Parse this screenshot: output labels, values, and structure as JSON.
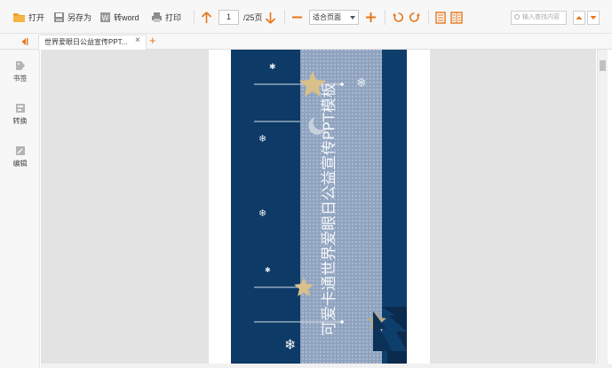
{
  "toolbar": {
    "open_label": "打开",
    "saveas_label": "另存为",
    "toword_label": "转word",
    "print_label": "打印",
    "page_current": "1",
    "page_total": "/25页",
    "zoom_value": "适合页面",
    "search_placeholder": "输入查找内容"
  },
  "tab": {
    "title": "世界爱眼日公益宣传PPT...",
    "close_glyph": "×",
    "add_glyph": "+"
  },
  "sidebar": {
    "items": [
      {
        "label": "书签",
        "icon": "bookmark-icon"
      },
      {
        "label": "转换",
        "icon": "convert-icon"
      },
      {
        "label": "编辑",
        "icon": "edit-icon"
      }
    ]
  },
  "slide": {
    "title": "可爱卡通世界爱眼日公益宣传PPT模板"
  },
  "colors": {
    "accent": "#e8761a",
    "slide_bg": "#0d3a66",
    "slide_panel": "#8fa3bf",
    "star": "#d9c08a"
  }
}
